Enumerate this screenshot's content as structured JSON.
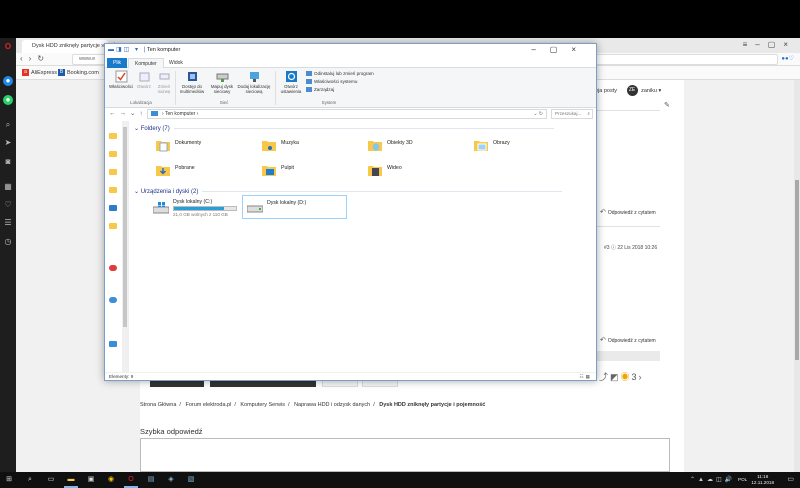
{
  "browser": {
    "tab_title": "Dysk HDD zniknęły partycje",
    "address": "www.e",
    "bookmarks": [
      {
        "label": "AliExpress",
        "color": "#e43225"
      },
      {
        "label": "Booking.com",
        "color": "#1f5aa8"
      }
    ]
  },
  "webpage": {
    "user_menu_label": "ęja posty",
    "user_initials": "ZE",
    "user_name": "zaniku",
    "reply_link": "Odpowiedź z cytatem",
    "post_date": "22 Lis 2018 10:26",
    "share_count": "3",
    "breadcrumb": [
      "Strona Główna",
      "Forum elektroda.pl",
      "Komputery Serwis",
      "Naprawa HDD i odzysk danych"
    ],
    "breadcrumb_current": "Dysk HDD zniknęły partycje i pojemność",
    "quick_reply_title": "Szybka odpowiedź"
  },
  "explorer": {
    "title": "Ten komputer",
    "tabs": {
      "file": "Plik",
      "computer": "Komputer",
      "view": "Widok"
    },
    "ribbon": {
      "properties": "Właściwości",
      "open": "Otwórz",
      "rename": "Zmień nazwę",
      "access_media": "Dostęp do multimediów",
      "map_drive": "Mapuj dysk sieciowy",
      "add_location": "Dodaj lokalizację sieciową",
      "open_settings": "Otwórz ustawienia",
      "uninstall": "Odinstaluj lub zmień program",
      "system_props": "Właściwości systemu",
      "manage": "Zarządzaj",
      "group_location": "Lokalizacja",
      "group_network": "Sieć",
      "group_system": "System"
    },
    "path": "Ten komputer",
    "search_placeholder": "Przeszukaj...",
    "folders_header": "Foldery (7)",
    "folders": [
      {
        "name": "Dokumenty",
        "overlay": "document"
      },
      {
        "name": "Muzyka",
        "overlay": "music"
      },
      {
        "name": "Obiekty 3D",
        "overlay": "3d"
      },
      {
        "name": "Obrazy",
        "overlay": "picture"
      },
      {
        "name": "Pobrane",
        "overlay": "download"
      },
      {
        "name": "Pulpit",
        "overlay": "desktop"
      },
      {
        "name": "Wideo",
        "overlay": "video"
      }
    ],
    "devices_header": "Urządzenia i dyski (2)",
    "drives": [
      {
        "name": "Dysk lokalny (C:)",
        "free": "21,0 GB wolnych z 110 GB",
        "used_fraction": 0.81,
        "icon": "windows-drive-icon"
      },
      {
        "name": "Dysk lokalny (D:)",
        "free": "",
        "used_fraction": null,
        "icon": "drive-icon"
      }
    ],
    "status": "Elementy: 9"
  },
  "taskbar": {
    "lang": "POL",
    "time": "11:16",
    "date": "12.11.2018"
  }
}
